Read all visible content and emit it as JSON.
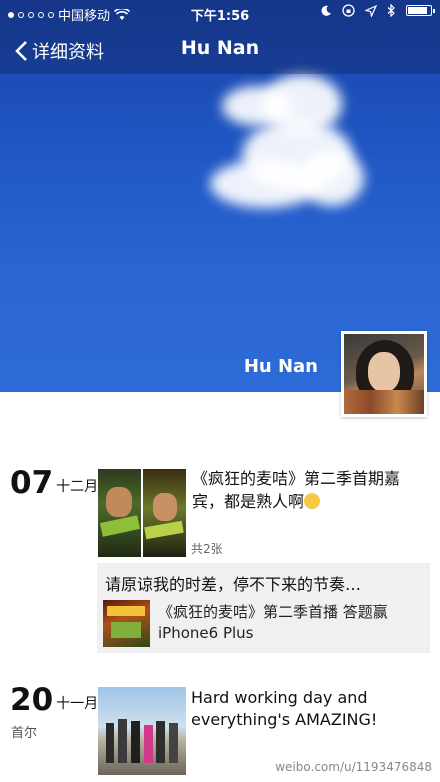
{
  "status": {
    "carrier": "中国移动",
    "time": "下午1:56"
  },
  "nav": {
    "back_label": "详细资料",
    "title": "Hu Nan"
  },
  "profile": {
    "name": "Hu Nan"
  },
  "posts": [
    {
      "day": "07",
      "month": "十二月",
      "text": "《疯狂的麦咭》第二季首期嘉宾，都是熟人啊",
      "count": "共2张",
      "share": {
        "caption": "请原谅我的时差，停不下来的节奏…",
        "text": "《疯狂的麦咭》第二季首播 答题赢iPhone6 Plus"
      }
    },
    {
      "day": "20",
      "month": "十一月",
      "location": "首尔",
      "text": "Hard working day and everything's AMAZING!"
    }
  ],
  "watermark": "weibo.com/u/1193476848"
}
